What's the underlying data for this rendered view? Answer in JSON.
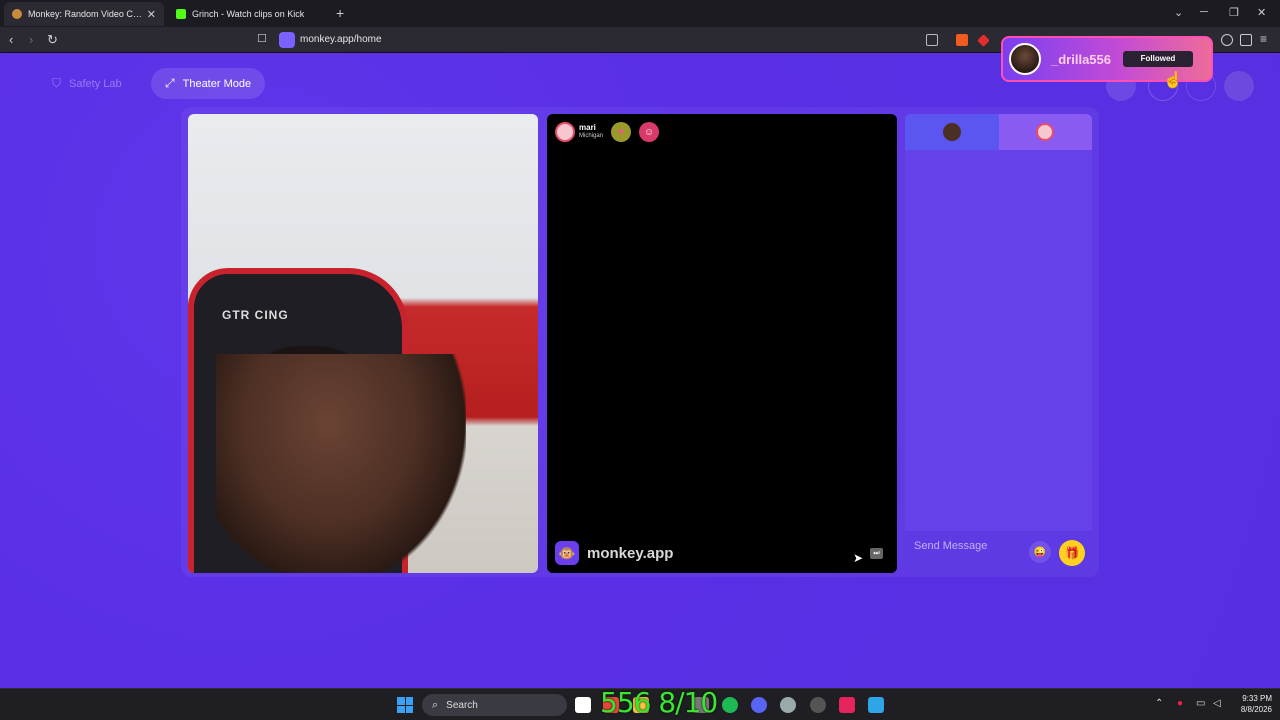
{
  "browser": {
    "tabs": [
      {
        "title": "Monkey: Random Video Chat",
        "active": true
      },
      {
        "title": "Grinch - Watch clips on Kick",
        "active": false
      }
    ],
    "new_tab_icon": "plus-icon",
    "url": "monkey.app/home"
  },
  "page": {
    "safety_lab_label": "Safety Lab",
    "theater_mode_label": "Theater Mode"
  },
  "peer": {
    "name": "mari",
    "location": "Michigan"
  },
  "brand": {
    "name": "monkey.app",
    "logo_glyph": "🐵"
  },
  "chat": {
    "input_placeholder": "Send Message",
    "emoji_glyph": "😜",
    "gift_glyph": "🎁"
  },
  "follow_card": {
    "username": "_drilla556",
    "button_label": "Followed"
  },
  "taskbar": {
    "search_label": "Search",
    "overlay_text": "556 8/10",
    "time": "9:33 PM",
    "date": "8/8/2026"
  },
  "colors": {
    "page_bg": "#5b30e6",
    "accent_yellow": "#ffd21f",
    "followed_pink": "#ff4fb3"
  }
}
